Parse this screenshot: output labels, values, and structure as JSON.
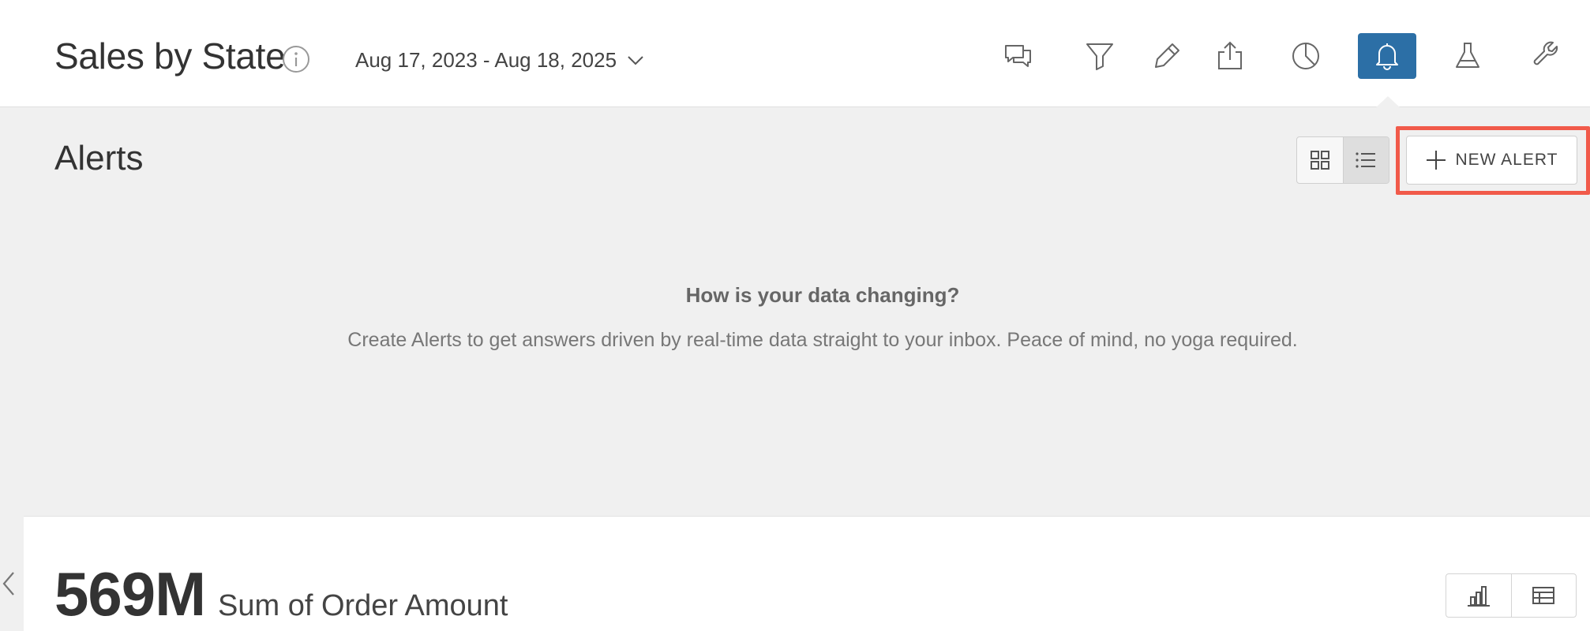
{
  "header": {
    "title": "Sales by State",
    "date_range": "Aug 17, 2023 - Aug 18, 2025",
    "active_tool": "alerts",
    "tools": [
      {
        "name": "comments-icon"
      },
      {
        "name": "filter-icon"
      },
      {
        "name": "edit-pencil-icon"
      },
      {
        "name": "share-export-icon"
      },
      {
        "name": "pie-chart-icon"
      },
      {
        "name": "bell-icon"
      },
      {
        "name": "flask-icon"
      },
      {
        "name": "wrench-icon"
      }
    ]
  },
  "alerts": {
    "title": "Alerts",
    "new_alert_label": "NEW ALERT",
    "empty_heading": "How is your data changing?",
    "empty_body": "Create Alerts to get answers driven by real-time data straight to your inbox. Peace of mind, no yoga required."
  },
  "metric": {
    "value": "569M",
    "label": "Sum of Order Amount"
  },
  "colors": {
    "accent": "#2c6fa6",
    "highlight": "#f15a4a",
    "panel_bg": "#f0f0f0"
  }
}
